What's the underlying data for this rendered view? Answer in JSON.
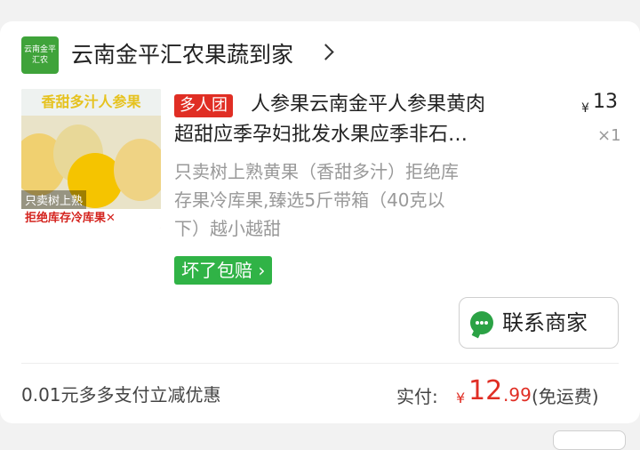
{
  "store": {
    "logo_text": "云南金平汇农",
    "name": "云南金平汇农果蔬到家"
  },
  "product": {
    "image_banner": "香甜多汁人参果",
    "image_caption": "只卖树上熟",
    "image_warning": "拒绝库存冷库果✕",
    "group_badge": "多人团",
    "title_line1": "人参果云南金平人参果黄肉",
    "title_line2": "超甜应季孕妇批发水果应季非石…",
    "price_symbol": "¥",
    "price": "13",
    "quantity": "×1",
    "desc_line1": "只卖树上熟黄果（香甜多汁）拒绝库",
    "desc_line2": "存果冷库果,臻选5斤带箱（40克以",
    "desc_line3": "下）越小越甜",
    "guarantee": "坏了包赔 ›"
  },
  "actions": {
    "contact_label": "联系商家"
  },
  "footer": {
    "promo": "0.01元多多支付立减优惠",
    "paid_label": "实付:",
    "paid_symbol": "¥",
    "paid_integer": "12",
    "paid_decimal": ".99",
    "paid_note": "(免运费)"
  },
  "colors": {
    "accent_red": "#e02e24",
    "guarantee_green": "#30b346",
    "chat_green": "#2ba245"
  }
}
